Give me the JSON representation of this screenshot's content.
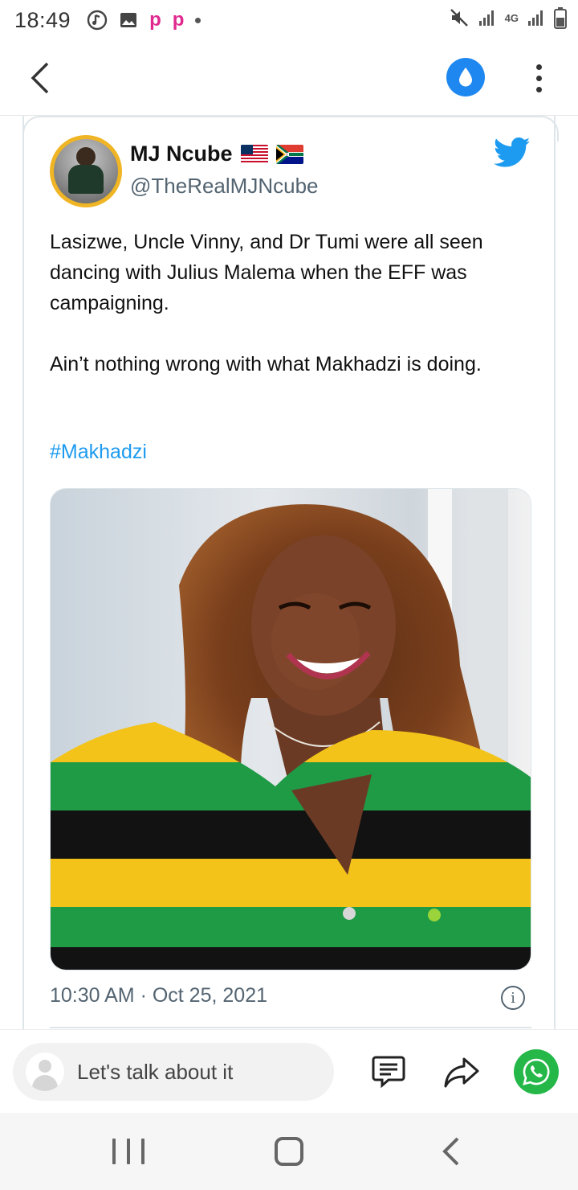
{
  "status_bar": {
    "time": "18:49",
    "network_label": "4G"
  },
  "header": {
    "back_icon": "chevron-left-icon",
    "drop_icon": "water-drop-icon",
    "more_icon": "more-vertical-icon"
  },
  "tweet": {
    "author_name": "MJ Ncube",
    "author_handle": "@TheRealMJNcube",
    "paragraph_1": "Lasizwe, Uncle Vinny, and Dr Tumi were all seen dancing with Julius Malema when the EFF was campaigning.",
    "paragraph_2": "Ain’t nothing wrong with what Makhadzi is doing.",
    "hashtag": "#Makhadzi",
    "timestamp": "10:30 AM · Oct 25, 2021",
    "info_glyph": "i",
    "brand_color": "#1d9bf0"
  },
  "comment_bar": {
    "placeholder": "Let's talk about it",
    "whatsapp_color": "#25b848"
  },
  "nav_bar": {
    "recent_icon": "recent-apps-icon",
    "home_icon": "home-icon",
    "back_icon": "back-icon"
  }
}
